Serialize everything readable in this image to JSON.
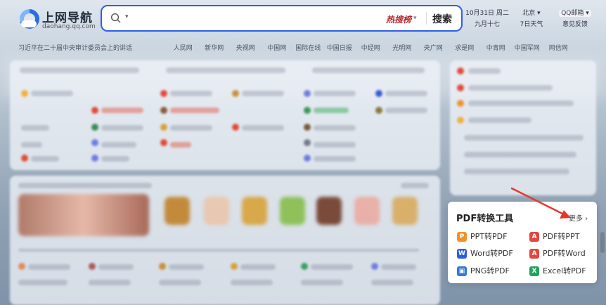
{
  "logo": {
    "title": "上网导航",
    "subtitle": "daohang.qq.com"
  },
  "search": {
    "value": "",
    "placeholder": "",
    "hot_label": "热搜榜",
    "button_label": "搜索"
  },
  "date": {
    "solar": "10月31日 周二",
    "lunar": "九月十七"
  },
  "weather": {
    "city": "北京",
    "forecast": "7日天气"
  },
  "qq": {
    "mail": "QQ邮箱",
    "feedback": "意见反馈"
  },
  "newsbar": {
    "headline": "习近平在二十届中央审计委员会上的讲话",
    "links": [
      "人民网",
      "新华网",
      "央视网",
      "中国网",
      "国际在线",
      "中国日报",
      "中经网",
      "光明网",
      "央广网",
      "求是网",
      "中青网",
      "中国军网",
      "网信网"
    ]
  },
  "pdf_tools": {
    "title": "PDF转换工具",
    "more": "更多",
    "items": [
      {
        "label": "PPT转PDF",
        "color": "#f0922b",
        "glyph": "P"
      },
      {
        "label": "PDF转PPT",
        "color": "#e2463e",
        "glyph": "A"
      },
      {
        "label": "Word转PDF",
        "color": "#2b5fd9",
        "glyph": "W"
      },
      {
        "label": "PDF转Word",
        "color": "#e2463e",
        "glyph": "A"
      },
      {
        "label": "PNG转PDF",
        "color": "#2e7bd6",
        "glyph": "▣"
      },
      {
        "label": "Excel转PDF",
        "color": "#23a35a",
        "glyph": "X"
      }
    ]
  },
  "colors": {
    "accent": "#2f5fe3",
    "hot": "#b4262a",
    "arrow": "#e5382d"
  }
}
